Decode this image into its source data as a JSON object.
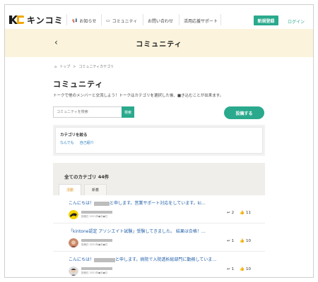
{
  "logo": {
    "text": "キンコミ"
  },
  "nav": {
    "items": [
      {
        "icon": "megaphone-icon",
        "glyph": "📢",
        "label": "お知らせ"
      },
      {
        "icon": "chat-icon",
        "glyph": "▭",
        "label": "コミュニティ"
      },
      {
        "icon": "",
        "glyph": "",
        "label": "お問い合わせ"
      },
      {
        "icon": "",
        "glyph": "",
        "label": "活用応援サポート"
      }
    ],
    "register_label": "新規登録",
    "login_label": "ログイン"
  },
  "band": {
    "back": "‹",
    "title": "コミュニティ"
  },
  "breadcrumb": {
    "home_glyph": "⌂",
    "home": "トップ",
    "sep": ">",
    "current": "コミュニティカテゴリ"
  },
  "page": {
    "title": "コミュニティ",
    "description": "トークで他のメンバーと交流しよう！トークはカテゴリを選択した後、■き込むことが出来ます。"
  },
  "search": {
    "placeholder": "コミュニティを検索",
    "button": "検索"
  },
  "post_button": "投稿する",
  "filter": {
    "title": "カテゴリを絞る",
    "links": [
      "なんでも",
      "自己紹介"
    ]
  },
  "categories": {
    "title": "全てのカテゴリ 44件",
    "tabs": [
      "活動",
      "新着"
    ]
  },
  "posts": [
    {
      "title_pre": "こんにちは！",
      "title_post": "と申します。営業サポート対応をしています。ki…",
      "date": "投稿日 2021年●月●日",
      "comments": "2",
      "likes": "11"
    },
    {
      "title_pre": "「kintone認定 アソシエイト試験」受験してきました。 結果は合格！…",
      "title_post": "",
      "date": "投稿日 2021年●月●日",
      "comments": "1",
      "likes": "10"
    },
    {
      "title_pre": "こんにちは！",
      "title_post": "と申します。病院で入院透析総部門に勤務していま…",
      "date": "投稿日 2021年●月●日",
      "comments": "1",
      "likes": "10"
    }
  ],
  "colors": {
    "accent": "#2aa98d",
    "band": "#fbf3dc",
    "link": "#1f5ea8",
    "tab_active": "#e09a2a"
  }
}
